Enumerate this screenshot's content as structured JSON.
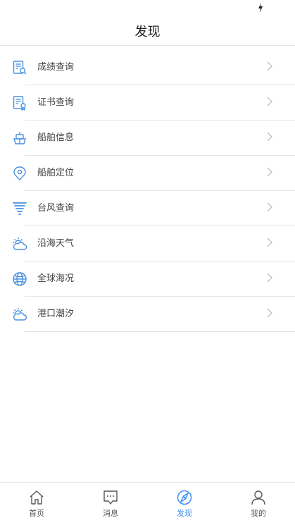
{
  "header": {
    "title": "发现"
  },
  "menu": {
    "items": [
      {
        "label": "成绩查询",
        "icon": "score-query-icon"
      },
      {
        "label": "证书查询",
        "icon": "certificate-icon"
      },
      {
        "label": "船舶信息",
        "icon": "ship-icon"
      },
      {
        "label": "船舶定位",
        "icon": "location-pin-icon"
      },
      {
        "label": "台风查询",
        "icon": "typhoon-icon"
      },
      {
        "label": "沿海天气",
        "icon": "weather-cloud-sun-icon"
      },
      {
        "label": "全球海况",
        "icon": "globe-icon"
      },
      {
        "label": "港口潮汐",
        "icon": "tide-cloud-sun-icon"
      }
    ]
  },
  "tabbar": {
    "tabs": [
      {
        "label": "首页",
        "icon": "home-icon",
        "active": false
      },
      {
        "label": "消息",
        "icon": "message-icon",
        "active": false
      },
      {
        "label": "发现",
        "icon": "compass-icon",
        "active": true
      },
      {
        "label": "我的",
        "icon": "user-icon",
        "active": false
      }
    ]
  },
  "colors": {
    "accent": "#3d8ff0",
    "icon": "#4a90e2",
    "text": "#444444",
    "divider": "#e5e5e5"
  }
}
